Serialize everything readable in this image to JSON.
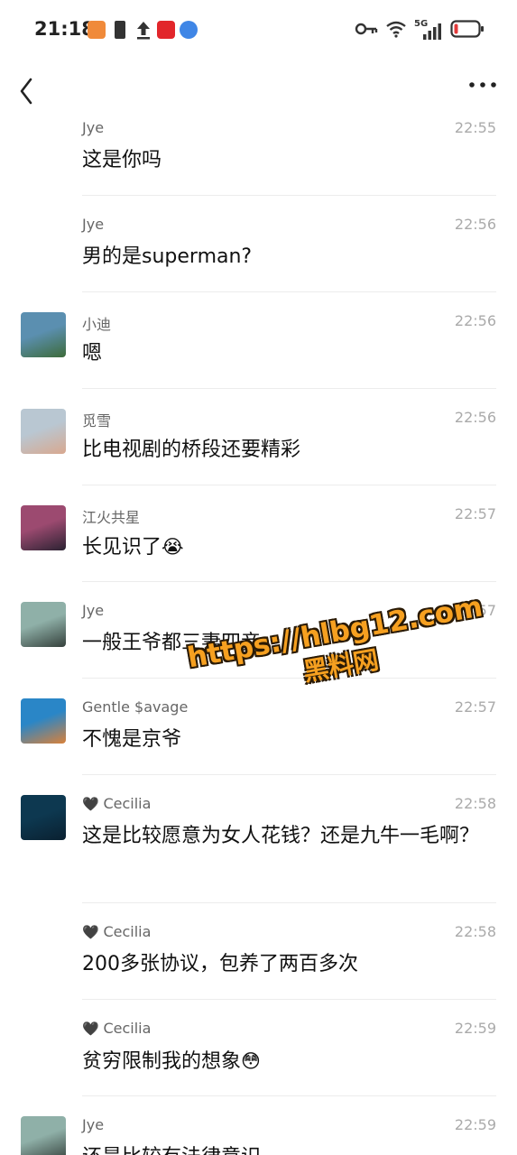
{
  "status_bar": {
    "time": "21:18",
    "network": "5G",
    "battery_level": 0.12
  },
  "nav": {
    "back_icon": "chevron-left-icon",
    "more_icon": "more-dots-icon"
  },
  "messages": [
    {
      "sender": "Jye",
      "time": "22:55",
      "text": "这是你吗",
      "avatar": false
    },
    {
      "sender": "Jye",
      "time": "22:56",
      "text": "男的是superman?",
      "avatar": false
    },
    {
      "sender": "小迪",
      "time": "22:56",
      "text": "嗯",
      "avatar": true,
      "avatar_colors": [
        "#5b8fb0",
        "#3d6b3a"
      ]
    },
    {
      "sender": "觅雪",
      "time": "22:56",
      "text": "比电视剧的桥段还要精彩",
      "avatar": true,
      "avatar_colors": [
        "#b9c7d2",
        "#d8a88f"
      ]
    },
    {
      "sender": "江火共星",
      "time": "22:57",
      "text": "长见识了",
      "emoji": "😭",
      "avatar": true,
      "avatar_colors": [
        "#9c4a70",
        "#2b2232"
      ]
    },
    {
      "sender": "Jye",
      "time": "22:57",
      "text": "一般王爷都三妻四妾",
      "avatar": true,
      "avatar_colors": [
        "#8fb0a8",
        "#35413c"
      ]
    },
    {
      "sender": "Gentle $avage",
      "time": "22:57",
      "text": "不愧是京爷",
      "avatar": true,
      "avatar_colors": [
        "#2a86c7",
        "#d9813a"
      ]
    },
    {
      "sender": "Cecilia",
      "time": "22:58",
      "text": "这是比较愿意为女人花钱？还是九牛一毛啊？",
      "avatar": true,
      "heart": "🖤",
      "avatar_colors": [
        "#0d3850",
        "#0a2030"
      ]
    },
    {
      "sender": "Cecilia",
      "time": "22:58",
      "text": "200多张协议，包养了两百多次",
      "avatar": false,
      "heart": "🖤"
    },
    {
      "sender": "Cecilia",
      "time": "22:59",
      "text": "贫穷限制我的想象",
      "emoji": "😳",
      "avatar": false,
      "heart": "🖤"
    },
    {
      "sender": "Jye",
      "time": "22:59",
      "text": "还是比较有法律意识",
      "avatar": true,
      "avatar_colors": [
        "#8fb0a8",
        "#35413c"
      ]
    }
  ],
  "watermark": {
    "url": "https://hlbg12.com",
    "name": "黑料网"
  }
}
